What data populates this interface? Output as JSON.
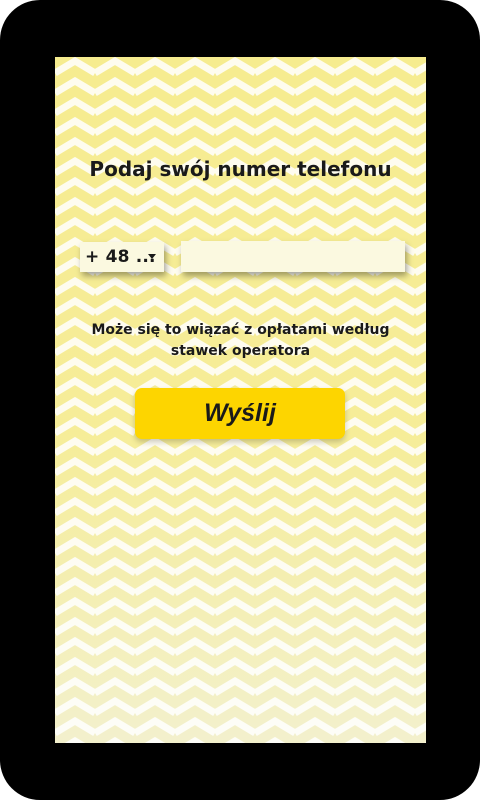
{
  "login": {
    "title": "Podaj swój numer telefonu",
    "country_code": "+ 48 ...",
    "phone_value": "",
    "note": "Może się to wiązać z opłatami według stawek operatora",
    "send_label": "Wyślij"
  },
  "icons": {
    "dropdown": "chevron-down-icon"
  },
  "colors": {
    "frame": "#000000",
    "background": "#f1f3ee",
    "pattern": "#f7ee9a",
    "input_background": "#fbf9e0",
    "button": "#fdd500",
    "text": "#1a1a1a"
  }
}
